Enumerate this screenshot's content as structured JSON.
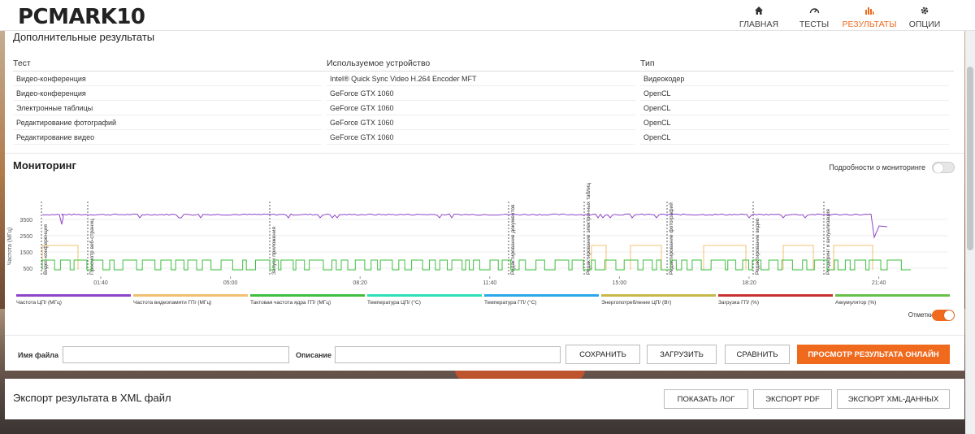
{
  "app": {
    "logo_main": "PCMARK",
    "logo_num": "10"
  },
  "nav": [
    {
      "label": "ГЛАВНАЯ",
      "icon": "home-icon",
      "active": false
    },
    {
      "label": "ТЕСТЫ",
      "icon": "gauge-icon",
      "active": false
    },
    {
      "label": "РЕЗУЛЬТАТЫ",
      "icon": "bar-chart-icon",
      "active": true
    },
    {
      "label": "ОПЦИИ",
      "icon": "gear-icon",
      "active": false
    }
  ],
  "additional": {
    "title": "Дополнительные результаты",
    "headers": [
      "Тест",
      "Используемое устройство",
      "Тип"
    ],
    "rows": [
      [
        "Видео-конференция",
        "Intel® Quick Sync Video H.264 Encoder MFT",
        "Видеокодер"
      ],
      [
        "Видео-конференция",
        "GeForce GTX 1060",
        "OpenCL"
      ],
      [
        "Электронные таблицы",
        "GeForce GTX 1060",
        "OpenCL"
      ],
      [
        "Редактирование фотографий",
        "GeForce GTX 1060",
        "OpenCL"
      ],
      [
        "Редактирование видео",
        "GeForce GTX 1060",
        "OpenCL"
      ]
    ]
  },
  "monitoring": {
    "title": "Мониторинг",
    "details_toggle_label": "Подробности о мониторинге",
    "marks_label": "Отметки",
    "legend": [
      {
        "label": "Частота ЦП/ (МГц)",
        "color": "#8e44c9"
      },
      {
        "label": "Частота видеопамяти ГП/ (МГц)",
        "color": "#f0c070"
      },
      {
        "label": "Тактовая частота ядра ГП/ (МГц)",
        "color": "#3fbf3f"
      },
      {
        "label": "Температура ЦП/ (°C)",
        "color": "#2de0b8"
      },
      {
        "label": "Температура ГП/ (°C)",
        "color": "#29a8e8"
      },
      {
        "label": "Энергопотребление ЦП/ (Вт)",
        "color": "#c7b84a"
      },
      {
        "label": "Загрузка ГП/ (%)",
        "color": "#c83030"
      },
      {
        "label": "Аккумулятор (%)",
        "color": "#66c04a"
      }
    ]
  },
  "chart_data": {
    "type": "line",
    "ylabel": "Частота (МГц)",
    "y_ticks": [
      500,
      1500,
      2500,
      3500
    ],
    "x_ticks": [
      "01:40",
      "05:00",
      "08:20",
      "11:40",
      "15:00",
      "18:20",
      "21:40"
    ],
    "markers": [
      "Видео-конференция",
      "Просмотр веб-страниц",
      "Запуск приложения",
      "Редактирование документов",
      "Редактирование электронных таблиц",
      "Редактирование фотографий",
      "Редактирование видео",
      "Рендеринг и визуализация"
    ],
    "series": [
      {
        "name": "Частота ЦП/ (МГц)",
        "approx_level": 3800
      },
      {
        "name": "Частота видеопамяти ГП/ (МГц)",
        "approx_level": 1900
      },
      {
        "name": "Тактовая частота ядра ГП/ (МГц)",
        "approx_level": 1000
      }
    ]
  },
  "form": {
    "filename_label": "Имя файла",
    "description_label": "Описание",
    "save_label": "СОХРАНИТЬ",
    "load_label": "ЗАГРУЗИТЬ",
    "compare_label": "СРАВНИТЬ",
    "online_label": "ПРОСМОТР РЕЗУЛЬТАТА ОНЛАЙН"
  },
  "export": {
    "title": "Экспорт результата в XML файл",
    "show_log": "ПОКАЗАТЬ ЛОГ",
    "export_pdf": "ЭКСПОРТ PDF",
    "export_xml": "ЭКСПОРТ XML-ДАННЫХ"
  }
}
